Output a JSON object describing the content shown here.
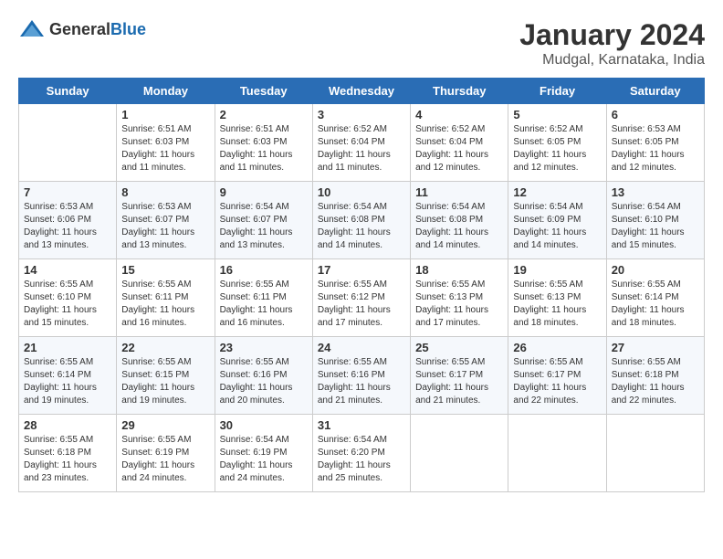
{
  "header": {
    "logo_general": "General",
    "logo_blue": "Blue",
    "month": "January 2024",
    "location": "Mudgal, Karnataka, India"
  },
  "days_of_week": [
    "Sunday",
    "Monday",
    "Tuesday",
    "Wednesday",
    "Thursday",
    "Friday",
    "Saturday"
  ],
  "weeks": [
    [
      {
        "day": "",
        "info": ""
      },
      {
        "day": "1",
        "info": "Sunrise: 6:51 AM\nSunset: 6:03 PM\nDaylight: 11 hours\nand 11 minutes."
      },
      {
        "day": "2",
        "info": "Sunrise: 6:51 AM\nSunset: 6:03 PM\nDaylight: 11 hours\nand 11 minutes."
      },
      {
        "day": "3",
        "info": "Sunrise: 6:52 AM\nSunset: 6:04 PM\nDaylight: 11 hours\nand 11 minutes."
      },
      {
        "day": "4",
        "info": "Sunrise: 6:52 AM\nSunset: 6:04 PM\nDaylight: 11 hours\nand 12 minutes."
      },
      {
        "day": "5",
        "info": "Sunrise: 6:52 AM\nSunset: 6:05 PM\nDaylight: 11 hours\nand 12 minutes."
      },
      {
        "day": "6",
        "info": "Sunrise: 6:53 AM\nSunset: 6:05 PM\nDaylight: 11 hours\nand 12 minutes."
      }
    ],
    [
      {
        "day": "7",
        "info": "Sunrise: 6:53 AM\nSunset: 6:06 PM\nDaylight: 11 hours\nand 13 minutes."
      },
      {
        "day": "8",
        "info": "Sunrise: 6:53 AM\nSunset: 6:07 PM\nDaylight: 11 hours\nand 13 minutes."
      },
      {
        "day": "9",
        "info": "Sunrise: 6:54 AM\nSunset: 6:07 PM\nDaylight: 11 hours\nand 13 minutes."
      },
      {
        "day": "10",
        "info": "Sunrise: 6:54 AM\nSunset: 6:08 PM\nDaylight: 11 hours\nand 14 minutes."
      },
      {
        "day": "11",
        "info": "Sunrise: 6:54 AM\nSunset: 6:08 PM\nDaylight: 11 hours\nand 14 minutes."
      },
      {
        "day": "12",
        "info": "Sunrise: 6:54 AM\nSunset: 6:09 PM\nDaylight: 11 hours\nand 14 minutes."
      },
      {
        "day": "13",
        "info": "Sunrise: 6:54 AM\nSunset: 6:10 PM\nDaylight: 11 hours\nand 15 minutes."
      }
    ],
    [
      {
        "day": "14",
        "info": "Sunrise: 6:55 AM\nSunset: 6:10 PM\nDaylight: 11 hours\nand 15 minutes."
      },
      {
        "day": "15",
        "info": "Sunrise: 6:55 AM\nSunset: 6:11 PM\nDaylight: 11 hours\nand 16 minutes."
      },
      {
        "day": "16",
        "info": "Sunrise: 6:55 AM\nSunset: 6:11 PM\nDaylight: 11 hours\nand 16 minutes."
      },
      {
        "day": "17",
        "info": "Sunrise: 6:55 AM\nSunset: 6:12 PM\nDaylight: 11 hours\nand 17 minutes."
      },
      {
        "day": "18",
        "info": "Sunrise: 6:55 AM\nSunset: 6:13 PM\nDaylight: 11 hours\nand 17 minutes."
      },
      {
        "day": "19",
        "info": "Sunrise: 6:55 AM\nSunset: 6:13 PM\nDaylight: 11 hours\nand 18 minutes."
      },
      {
        "day": "20",
        "info": "Sunrise: 6:55 AM\nSunset: 6:14 PM\nDaylight: 11 hours\nand 18 minutes."
      }
    ],
    [
      {
        "day": "21",
        "info": "Sunrise: 6:55 AM\nSunset: 6:14 PM\nDaylight: 11 hours\nand 19 minutes."
      },
      {
        "day": "22",
        "info": "Sunrise: 6:55 AM\nSunset: 6:15 PM\nDaylight: 11 hours\nand 19 minutes."
      },
      {
        "day": "23",
        "info": "Sunrise: 6:55 AM\nSunset: 6:16 PM\nDaylight: 11 hours\nand 20 minutes."
      },
      {
        "day": "24",
        "info": "Sunrise: 6:55 AM\nSunset: 6:16 PM\nDaylight: 11 hours\nand 21 minutes."
      },
      {
        "day": "25",
        "info": "Sunrise: 6:55 AM\nSunset: 6:17 PM\nDaylight: 11 hours\nand 21 minutes."
      },
      {
        "day": "26",
        "info": "Sunrise: 6:55 AM\nSunset: 6:17 PM\nDaylight: 11 hours\nand 22 minutes."
      },
      {
        "day": "27",
        "info": "Sunrise: 6:55 AM\nSunset: 6:18 PM\nDaylight: 11 hours\nand 22 minutes."
      }
    ],
    [
      {
        "day": "28",
        "info": "Sunrise: 6:55 AM\nSunset: 6:18 PM\nDaylight: 11 hours\nand 23 minutes."
      },
      {
        "day": "29",
        "info": "Sunrise: 6:55 AM\nSunset: 6:19 PM\nDaylight: 11 hours\nand 24 minutes."
      },
      {
        "day": "30",
        "info": "Sunrise: 6:54 AM\nSunset: 6:19 PM\nDaylight: 11 hours\nand 24 minutes."
      },
      {
        "day": "31",
        "info": "Sunrise: 6:54 AM\nSunset: 6:20 PM\nDaylight: 11 hours\nand 25 minutes."
      },
      {
        "day": "",
        "info": ""
      },
      {
        "day": "",
        "info": ""
      },
      {
        "day": "",
        "info": ""
      }
    ]
  ]
}
